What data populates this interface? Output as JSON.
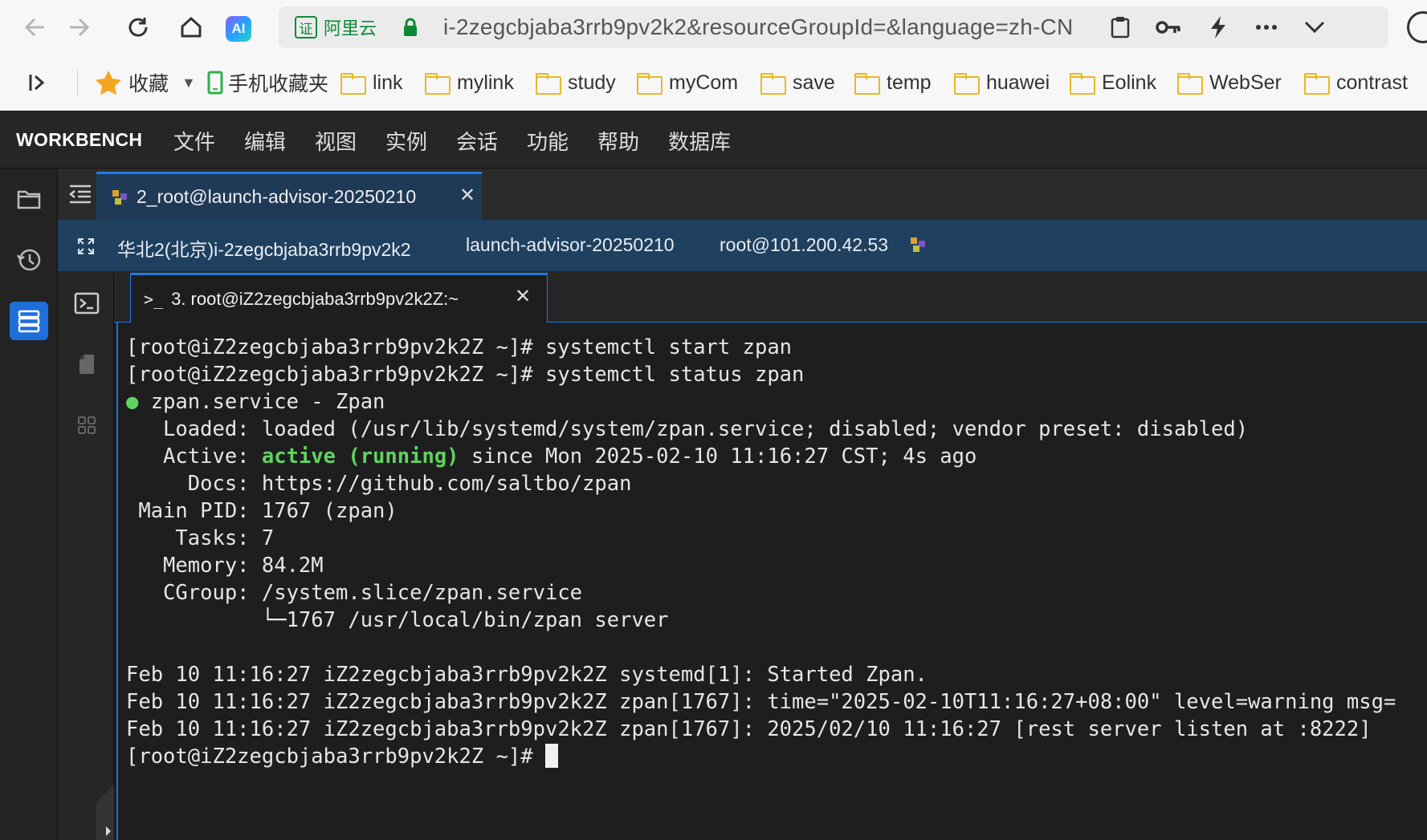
{
  "browser": {
    "site_name": "阿里云",
    "site_badge": "证",
    "url": "i-2zegcbjaba3rrb9pv2k2&resourceGroupId=&language=zh-CN",
    "ai_label": "AI"
  },
  "bookmarks": [
    {
      "label": "收藏",
      "icon": "star-icon"
    },
    {
      "label": "手机收藏夹",
      "icon": "phone-icon"
    },
    {
      "label": "link",
      "icon": "folder-icon"
    },
    {
      "label": "mylink",
      "icon": "folder-icon"
    },
    {
      "label": "study",
      "icon": "folder-icon"
    },
    {
      "label": "myCom",
      "icon": "folder-icon"
    },
    {
      "label": "save",
      "icon": "folder-icon"
    },
    {
      "label": "temp",
      "icon": "folder-icon"
    },
    {
      "label": "huawei",
      "icon": "folder-icon"
    },
    {
      "label": "Eolink",
      "icon": "folder-icon"
    },
    {
      "label": "WebSer",
      "icon": "folder-icon"
    },
    {
      "label": "contrast",
      "icon": "folder-icon"
    }
  ],
  "app": {
    "brand": "WORKBENCH",
    "menu": [
      "文件",
      "编辑",
      "视图",
      "实例",
      "会话",
      "功能",
      "帮助",
      "数据库"
    ]
  },
  "session": {
    "tab_label": "2_root@launch-advisor-20250210",
    "region": "华北2(北京)i-2zegcbjaba3rrb9pv2k2",
    "instance_name": "launch-advisor-20250210",
    "login": "root@101.200.42.53"
  },
  "terminal": {
    "tab_label": "3. root@iZ2zegcbjaba3rrb9pv2k2Z:~",
    "lines": [
      "[root@iZ2zegcbjaba3rrb9pv2k2Z ~]# systemctl start zpan",
      "[root@iZ2zegcbjaba3rrb9pv2k2Z ~]# systemctl status zpan",
      "zpan.service - Zpan",
      "   Loaded: loaded (/usr/lib/systemd/system/zpan.service; disabled; vendor preset: disabled)",
      "since Mon 2025-02-10 11:16:27 CST; 4s ago",
      "     Docs: https://github.com/saltbo/zpan",
      " Main PID: 1767 (zpan)",
      "    Tasks: 7",
      "   Memory: 84.2M",
      "   CGroup: /system.slice/zpan.service",
      "           └─1767 /usr/local/bin/zpan server",
      "",
      "Feb 10 11:16:27 iZ2zegcbjaba3rrb9pv2k2Z systemd[1]: Started Zpan.",
      "Feb 10 11:16:27 iZ2zegcbjaba3rrb9pv2k2Z zpan[1767]: time=\"2025-02-10T11:16:27+08:00\" level=warning msg=",
      "Feb 10 11:16:27 iZ2zegcbjaba3rrb9pv2k2Z zpan[1767]: 2025/02/10 11:16:27 [rest server listen at :8222]",
      "[root@iZ2zegcbjaba3rrb9pv2k2Z ~]# "
    ],
    "active_label": "   Active: ",
    "active_status": "active (running)",
    "status_dot": "●"
  }
}
